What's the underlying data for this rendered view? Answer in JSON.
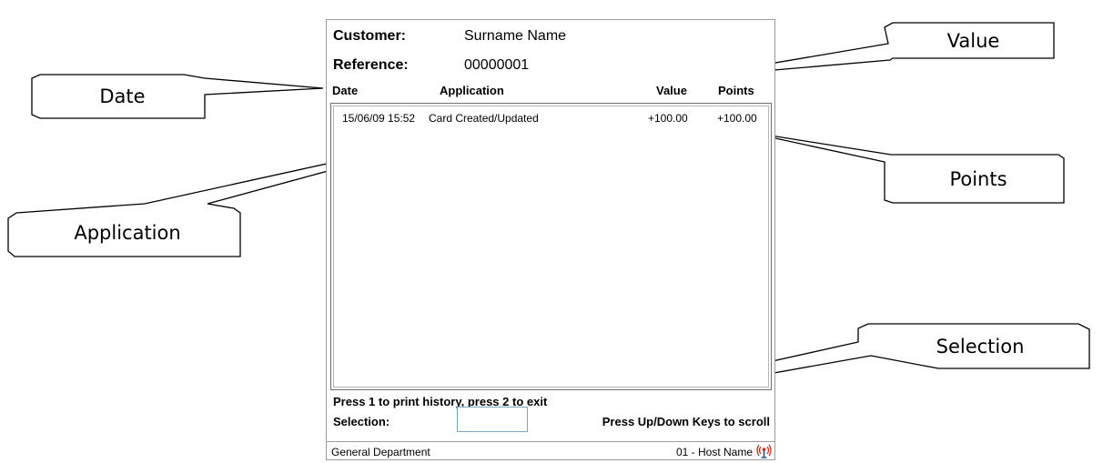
{
  "callouts": {
    "date": "Date",
    "application": "Application",
    "value": "Value",
    "points": "Points",
    "selection": "Selection"
  },
  "screen": {
    "customer_label": "Customer:",
    "customer_value": "Surname Name",
    "reference_label": "Reference:",
    "reference_value": "00000001",
    "columns": {
      "date": "Date",
      "application": "Application",
      "value": "Value",
      "points": "Points"
    },
    "history": [
      {
        "date": "15/06/09 15:52",
        "application": "Card Created/Updated",
        "value": "+100.00",
        "points": "+100.00"
      }
    ],
    "instruction": "Press 1 to print history, press 2 to exit",
    "selection_label": "Selection:",
    "selection_value": "",
    "scroll_hint": "Press Up/Down Keys to scroll",
    "status": {
      "department": "General Department",
      "host": "01 - Host Name",
      "icon": "signal-icon"
    }
  },
  "colors": {
    "frame_border": "#9a9a9a",
    "input_border": "#7aa6c4",
    "signal_icon": "#d03010"
  }
}
